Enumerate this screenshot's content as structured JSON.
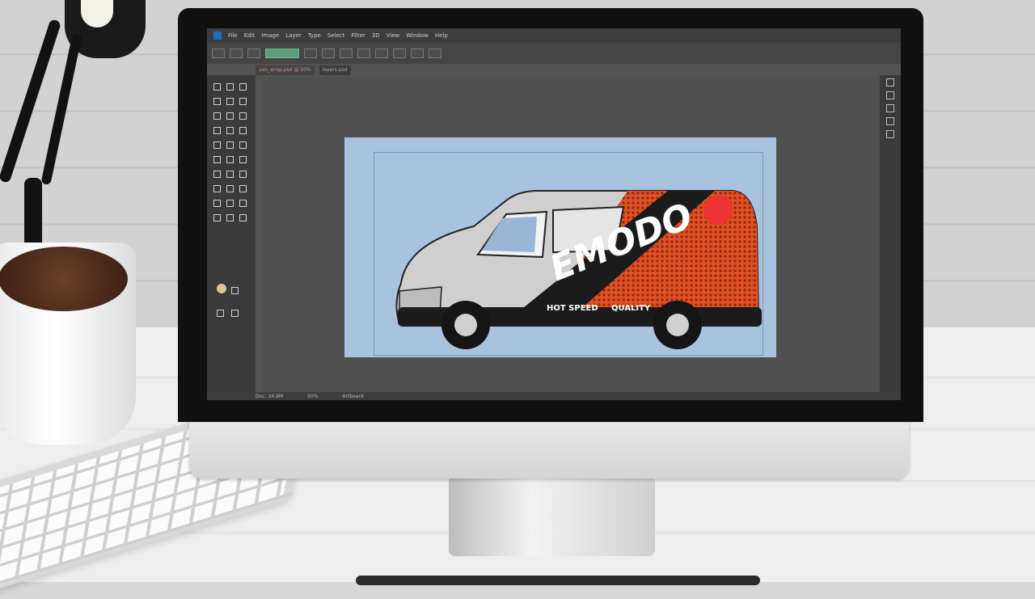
{
  "app": {
    "menu": [
      "Ps",
      "File",
      "Edit",
      "Image",
      "Layer",
      "Type",
      "Select",
      "Filter",
      "3D",
      "View",
      "Window",
      "Help"
    ]
  },
  "tabs": [
    "van_wrap.psd @ 50%",
    "layers.psd"
  ],
  "statusbar": [
    "Doc: 24.9M",
    "50%",
    "Artboard"
  ],
  "van": {
    "brand": "EMODO",
    "tagline": "HOT SPEED",
    "sub": "QUALITY"
  },
  "colors": {
    "accent_orange": "#e05022",
    "canvas_blue": "#a9c3df",
    "van_dark": "#1b1b1b"
  }
}
